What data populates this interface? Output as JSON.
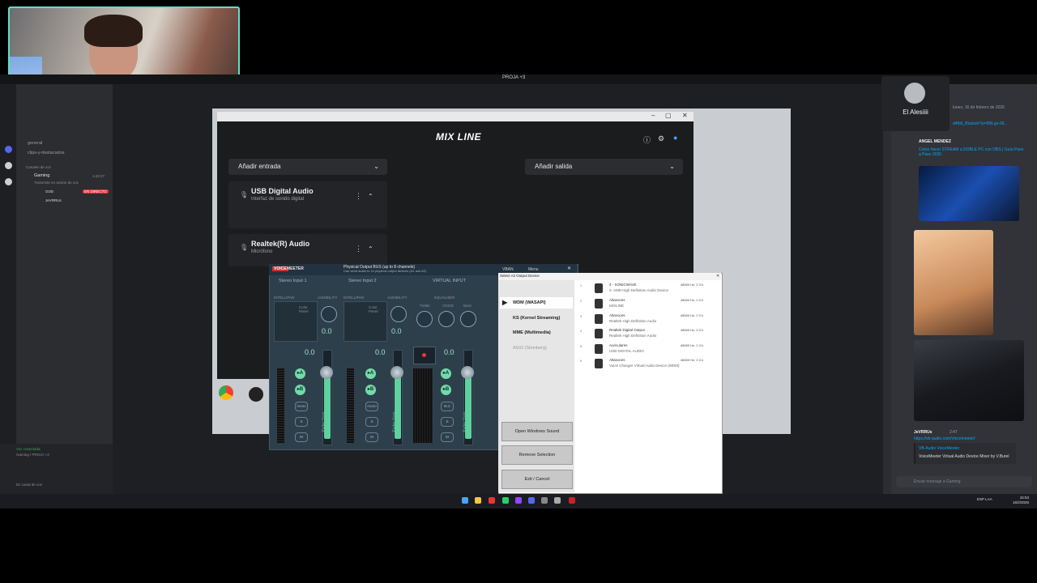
{
  "window_title": "PROJA +3",
  "discord": {
    "channels": [
      "general",
      "clips-y-destacados"
    ],
    "category": "Canales de voz",
    "voice_channel": "Gaming",
    "voice_time": "1:42:27",
    "voice_sub": "Transmite en sesión de voz",
    "users": [
      {
        "name": "GOD",
        "badge": ""
      },
      {
        "name": "JeVRRUs",
        "badge": "EN DIRECTO"
      }
    ],
    "voice_status": "Voz conectada",
    "voice_path": "Gaming / PROJA +3",
    "user_status": "En canal de voz",
    "caller_name": "El Alesiiii",
    "right_header": "lunes, 16 de febrero de 2026",
    "right_link_top": "d4fb6_Bluetoh?si=f9N.go-06...",
    "right_author": "ANGEL MENDEZ",
    "right_title": "Cómo hacer STREAM a DOBLE PC con OBS | Guía Paso a Paso 2026",
    "msg_author": "JeVRRUs",
    "msg_time": "2:47",
    "msg_link": "https://vb-audio.com/Voicemeeter/",
    "embed_title": "VB-Audio VoiceMeeter",
    "embed_desc": "VoiceMeeter Virtual Audio Device Mixer by V.Burel",
    "input_placeholder": "Enviar mensaje a Gaming"
  },
  "mixline": {
    "logo": "MIX LINE",
    "add_input": "Añadir entrada",
    "add_output": "Añadir salida",
    "devices": [
      {
        "name": "USB Digital Audio",
        "sub": "Interfaz de sonido digital"
      },
      {
        "name": "Realtek(R) Audio",
        "sub": "Micrófono"
      }
    ]
  },
  "voicemeeter": {
    "brand1": "VOICE",
    "brand2": "MEETER",
    "output_title": "Physical Output BUS (up to 8 channels)",
    "output_sub": "Can send audio to 2x physical output devices (A1 and A2)",
    "menu": "Menu",
    "vban": "VBAN",
    "strips": [
      {
        "label": "Stereo Input 1",
        "db": "0.0",
        "gain": "0.0"
      },
      {
        "label": "Stereo Input 2",
        "db": "0.0",
        "gain": "0.0"
      },
      {
        "label": "VIRTUAL INPUT",
        "db": "0.0",
        "gain": "0.0"
      }
    ],
    "intellipan": "INTELLIPAN",
    "audibility": "AUDIBILITY",
    "equalizer": "EQUALIZER",
    "treble": "Treble",
    "bass": "Bass",
    "mono": "mono",
    "mc": "M.C",
    "fader": "Fader Gain",
    "btn_a": "A",
    "btn_b": "B",
    "btn_s": "S",
    "btn_m": "M",
    "color_panel": "Color Panel",
    "voice": "VOICE"
  },
  "dialog": {
    "title": "Select A2 Output Device",
    "drivers": [
      "WDM (WASAPI)",
      "KS (Kernel Streaming)",
      "MME (Multimedia)",
      "ASIO (Steinberg)"
    ],
    "devices": [
      {
        "i": "1",
        "name": "4 - SONICWAVE",
        "sub": "2- AMD High Definition Audio Device",
        "freq": "48000 Hz, 2 Ch"
      },
      {
        "i": "2",
        "name": "Altavoces",
        "sub": "MIXLINE",
        "freq": "48000 Hz, 2 Ch"
      },
      {
        "i": "3",
        "name": "Altavoces",
        "sub": "Realtek High Definition Audio",
        "freq": "48000 Hz, 2 Ch"
      },
      {
        "i": "4",
        "name": "Realtek Digital Output",
        "sub": "Realtek High Definition Audio",
        "freq": "48000 Hz, 2 Ch"
      },
      {
        "i": "5",
        "name": "Auriculares",
        "sub": "USB DIGITAL AUDIO",
        "freq": "48000 Hz, 2 Ch"
      },
      {
        "i": "6",
        "name": "Altavoces",
        "sub": "Voice Changer Virtual Audio Device (WDM)",
        "freq": "48000 Hz, 2 Ch"
      }
    ],
    "btn_open": "Open Windows Sound",
    "btn_remove": "Remove Selection",
    "btn_exit": "Exit / Cancel"
  },
  "taskbar": {
    "lang": "ESP LAA",
    "time": "15:53",
    "date": "16/2/2026"
  }
}
